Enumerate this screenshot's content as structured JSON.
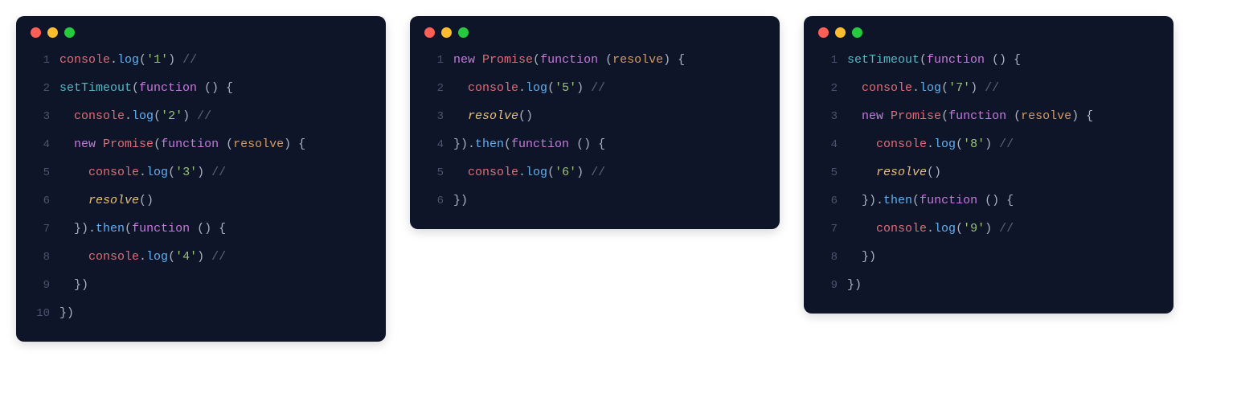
{
  "colors": {
    "bg": "#0f1528",
    "traffic_red": "#ff5f56",
    "traffic_yellow": "#ffbd2e",
    "traffic_green": "#27c93f",
    "obj": "#e06c75",
    "method": "#61afef",
    "keyword": "#c678dd",
    "builtin": "#56b6c2",
    "param": "#d19a66",
    "string": "#98c379",
    "punct": "#abb2bf",
    "comment": "#5c6370",
    "call": "#e5c07b"
  },
  "blocks": [
    {
      "lines": [
        {
          "n": "1",
          "indent": 0,
          "tokens": [
            {
              "cls": "obj",
              "t": "console"
            },
            {
              "cls": "punct",
              "t": "."
            },
            {
              "cls": "method",
              "t": "log"
            },
            {
              "cls": "punct",
              "t": "("
            },
            {
              "cls": "string",
              "t": "'1'"
            },
            {
              "cls": "punct",
              "t": ") "
            },
            {
              "cls": "comment",
              "t": "//"
            }
          ]
        },
        {
          "n": "2",
          "indent": 0,
          "tokens": [
            {
              "cls": "builtin",
              "t": "setTimeout"
            },
            {
              "cls": "punct",
              "t": "("
            },
            {
              "cls": "keyword",
              "t": "function"
            },
            {
              "cls": "punct",
              "t": " () {"
            }
          ]
        },
        {
          "n": "3",
          "indent": 1,
          "tokens": [
            {
              "cls": "obj",
              "t": "console"
            },
            {
              "cls": "punct",
              "t": "."
            },
            {
              "cls": "method",
              "t": "log"
            },
            {
              "cls": "punct",
              "t": "("
            },
            {
              "cls": "string",
              "t": "'2'"
            },
            {
              "cls": "punct",
              "t": ") "
            },
            {
              "cls": "comment",
              "t": "//"
            }
          ]
        },
        {
          "n": "4",
          "indent": 1,
          "tokens": [
            {
              "cls": "keyword",
              "t": "new"
            },
            {
              "cls": "plain",
              "t": " "
            },
            {
              "cls": "obj",
              "t": "Promise"
            },
            {
              "cls": "punct",
              "t": "("
            },
            {
              "cls": "keyword",
              "t": "function"
            },
            {
              "cls": "punct",
              "t": " ("
            },
            {
              "cls": "param",
              "t": "resolve"
            },
            {
              "cls": "punct",
              "t": ") {"
            }
          ]
        },
        {
          "n": "5",
          "indent": 2,
          "tokens": [
            {
              "cls": "obj",
              "t": "console"
            },
            {
              "cls": "punct",
              "t": "."
            },
            {
              "cls": "method",
              "t": "log"
            },
            {
              "cls": "punct",
              "t": "("
            },
            {
              "cls": "string",
              "t": "'3'"
            },
            {
              "cls": "punct",
              "t": ") "
            },
            {
              "cls": "comment",
              "t": "//"
            }
          ]
        },
        {
          "n": "6",
          "indent": 2,
          "tokens": [
            {
              "cls": "call",
              "t": "resolve"
            },
            {
              "cls": "punct",
              "t": "()"
            }
          ]
        },
        {
          "n": "7",
          "indent": 1,
          "tokens": [
            {
              "cls": "punct",
              "t": "})."
            },
            {
              "cls": "method",
              "t": "then"
            },
            {
              "cls": "punct",
              "t": "("
            },
            {
              "cls": "keyword",
              "t": "function"
            },
            {
              "cls": "punct",
              "t": " () {"
            }
          ]
        },
        {
          "n": "8",
          "indent": 2,
          "tokens": [
            {
              "cls": "obj",
              "t": "console"
            },
            {
              "cls": "punct",
              "t": "."
            },
            {
              "cls": "method",
              "t": "log"
            },
            {
              "cls": "punct",
              "t": "("
            },
            {
              "cls": "string",
              "t": "'4'"
            },
            {
              "cls": "punct",
              "t": ") "
            },
            {
              "cls": "comment",
              "t": "//"
            }
          ]
        },
        {
          "n": "9",
          "indent": 1,
          "tokens": [
            {
              "cls": "punct",
              "t": "})"
            }
          ]
        },
        {
          "n": "10",
          "indent": 0,
          "tokens": [
            {
              "cls": "punct",
              "t": "})"
            }
          ]
        }
      ]
    },
    {
      "lines": [
        {
          "n": "1",
          "indent": 0,
          "tokens": [
            {
              "cls": "keyword",
              "t": "new"
            },
            {
              "cls": "plain",
              "t": " "
            },
            {
              "cls": "obj",
              "t": "Promise"
            },
            {
              "cls": "punct",
              "t": "("
            },
            {
              "cls": "keyword",
              "t": "function"
            },
            {
              "cls": "punct",
              "t": " ("
            },
            {
              "cls": "param",
              "t": "resolve"
            },
            {
              "cls": "punct",
              "t": ") {"
            }
          ]
        },
        {
          "n": "2",
          "indent": 1,
          "tokens": [
            {
              "cls": "obj",
              "t": "console"
            },
            {
              "cls": "punct",
              "t": "."
            },
            {
              "cls": "method",
              "t": "log"
            },
            {
              "cls": "punct",
              "t": "("
            },
            {
              "cls": "string",
              "t": "'5'"
            },
            {
              "cls": "punct",
              "t": ") "
            },
            {
              "cls": "comment",
              "t": "//"
            }
          ]
        },
        {
          "n": "3",
          "indent": 1,
          "tokens": [
            {
              "cls": "call",
              "t": "resolve"
            },
            {
              "cls": "punct",
              "t": "()"
            }
          ]
        },
        {
          "n": "4",
          "indent": 0,
          "tokens": [
            {
              "cls": "punct",
              "t": "})."
            },
            {
              "cls": "method",
              "t": "then"
            },
            {
              "cls": "punct",
              "t": "("
            },
            {
              "cls": "keyword",
              "t": "function"
            },
            {
              "cls": "punct",
              "t": " () {"
            }
          ]
        },
        {
          "n": "5",
          "indent": 1,
          "tokens": [
            {
              "cls": "obj",
              "t": "console"
            },
            {
              "cls": "punct",
              "t": "."
            },
            {
              "cls": "method",
              "t": "log"
            },
            {
              "cls": "punct",
              "t": "("
            },
            {
              "cls": "string",
              "t": "'6'"
            },
            {
              "cls": "punct",
              "t": ") "
            },
            {
              "cls": "comment",
              "t": "//"
            }
          ]
        },
        {
          "n": "6",
          "indent": 0,
          "tokens": [
            {
              "cls": "punct",
              "t": "})"
            }
          ]
        }
      ]
    },
    {
      "lines": [
        {
          "n": "1",
          "indent": 0,
          "tokens": [
            {
              "cls": "builtin",
              "t": "setTimeout"
            },
            {
              "cls": "punct",
              "t": "("
            },
            {
              "cls": "keyword",
              "t": "function"
            },
            {
              "cls": "punct",
              "t": " () {"
            }
          ]
        },
        {
          "n": "2",
          "indent": 1,
          "tokens": [
            {
              "cls": "obj",
              "t": "console"
            },
            {
              "cls": "punct",
              "t": "."
            },
            {
              "cls": "method",
              "t": "log"
            },
            {
              "cls": "punct",
              "t": "("
            },
            {
              "cls": "string",
              "t": "'7'"
            },
            {
              "cls": "punct",
              "t": ") "
            },
            {
              "cls": "comment",
              "t": "//"
            }
          ]
        },
        {
          "n": "3",
          "indent": 1,
          "tokens": [
            {
              "cls": "keyword",
              "t": "new"
            },
            {
              "cls": "plain",
              "t": " "
            },
            {
              "cls": "obj",
              "t": "Promise"
            },
            {
              "cls": "punct",
              "t": "("
            },
            {
              "cls": "keyword",
              "t": "function"
            },
            {
              "cls": "punct",
              "t": " ("
            },
            {
              "cls": "param",
              "t": "resolve"
            },
            {
              "cls": "punct",
              "t": ") {"
            }
          ]
        },
        {
          "n": "4",
          "indent": 2,
          "tokens": [
            {
              "cls": "obj",
              "t": "console"
            },
            {
              "cls": "punct",
              "t": "."
            },
            {
              "cls": "method",
              "t": "log"
            },
            {
              "cls": "punct",
              "t": "("
            },
            {
              "cls": "string",
              "t": "'8'"
            },
            {
              "cls": "punct",
              "t": ") "
            },
            {
              "cls": "comment",
              "t": "//"
            }
          ]
        },
        {
          "n": "5",
          "indent": 2,
          "tokens": [
            {
              "cls": "call",
              "t": "resolve"
            },
            {
              "cls": "punct",
              "t": "()"
            }
          ]
        },
        {
          "n": "6",
          "indent": 1,
          "tokens": [
            {
              "cls": "punct",
              "t": "})."
            },
            {
              "cls": "method",
              "t": "then"
            },
            {
              "cls": "punct",
              "t": "("
            },
            {
              "cls": "keyword",
              "t": "function"
            },
            {
              "cls": "punct",
              "t": " () {"
            }
          ]
        },
        {
          "n": "7",
          "indent": 2,
          "tokens": [
            {
              "cls": "obj",
              "t": "console"
            },
            {
              "cls": "punct",
              "t": "."
            },
            {
              "cls": "method",
              "t": "log"
            },
            {
              "cls": "punct",
              "t": "("
            },
            {
              "cls": "string",
              "t": "'9'"
            },
            {
              "cls": "punct",
              "t": ") "
            },
            {
              "cls": "comment",
              "t": "//"
            }
          ]
        },
        {
          "n": "8",
          "indent": 1,
          "tokens": [
            {
              "cls": "punct",
              "t": "})"
            }
          ]
        },
        {
          "n": "9",
          "indent": 0,
          "tokens": [
            {
              "cls": "punct",
              "t": "})"
            }
          ]
        }
      ]
    }
  ]
}
